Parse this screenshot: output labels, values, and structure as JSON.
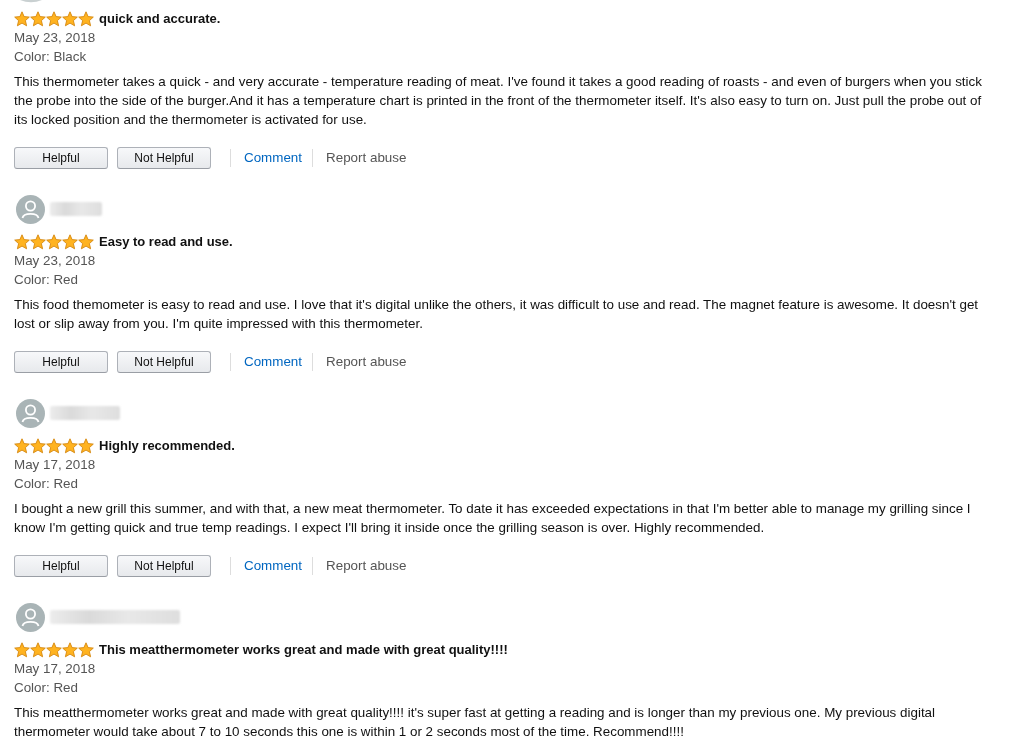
{
  "reviews": [
    {
      "kind": "cut_off",
      "stars": 5,
      "title": "quick and accurate.",
      "date": "May 23, 2018",
      "variant": "Color: Black",
      "body": "This thermometer takes a quick - and very accurate - temperature reading of meat. I've found it takes a good reading of roasts - and even of burgers when you stick the probe into the side of the burger.And it has a temperature chart is printed in the front of the thermometer itself. It's also easy to turn on. Just pull the probe out of its locked position and the thermometer is activated for use.",
      "actions": [
        {
          "kind": "helpful",
          "label": "Helpful"
        },
        {
          "kind": "not_helpful",
          "label": "Not Helpful"
        },
        {
          "kind": "comment",
          "label": "Comment"
        },
        {
          "kind": "report",
          "label": "Report abuse"
        }
      ]
    },
    {
      "kind": "full",
      "stars": 5,
      "title": "Easy to read and use.",
      "date": "May 23, 2018",
      "variant": "Color: Red",
      "body": "This food themometer is easy to read and use. I love that it's digital unlike the others, it was difficult to use and read. The magnet feature is awesome. It doesn't get lost or slip away from you. I'm quite impressed with this thermometer.",
      "actions": [
        {
          "kind": "helpful",
          "label": "Helpful"
        },
        {
          "kind": "not_helpful",
          "label": "Not Helpful"
        },
        {
          "kind": "comment",
          "label": "Comment"
        },
        {
          "kind": "report",
          "label": "Report abuse"
        }
      ]
    },
    {
      "kind": "full",
      "stars": 5,
      "title": "Highly recommended.",
      "date": "May 17, 2018",
      "variant": "Color: Red",
      "body": "I bought a new grill this summer, and with that, a new meat thermometer. To date it has exceeded expectations in that I'm better able to manage my grilling since I know I'm getting quick and true temp readings. I expect I'll bring it inside once the grilling season is over. Highly recommended.",
      "actions": [
        {
          "kind": "helpful",
          "label": "Helpful"
        },
        {
          "kind": "not_helpful",
          "label": "Not Helpful"
        },
        {
          "kind": "comment",
          "label": "Comment"
        },
        {
          "kind": "report",
          "label": "Report abuse"
        }
      ]
    },
    {
      "kind": "full",
      "stars": 5,
      "title": "This meatthermometer works great and made with great quality!!!!",
      "date": "May 17, 2018",
      "variant": "Color: Red",
      "body": "This meatthermometer works great and made with great quality!!!! it's super fast at getting a reading and is longer than my previous one. My previous digital thermometer would take about 7 to 10 seconds this one is within 1 or 2 seconds most of the time. Recommend!!!!"
    }
  ]
}
